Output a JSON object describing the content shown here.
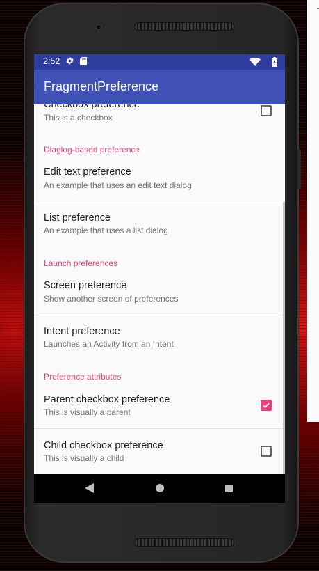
{
  "status_bar": {
    "time": "2:52"
  },
  "app_bar": {
    "title": "FragmentPreference"
  },
  "preferences": {
    "checkbox_pref": {
      "title": "Checkbox preference",
      "summary": "This is a checkbox",
      "checked": false
    },
    "category_dialog": "Diaglog-based preference",
    "edit_text_pref": {
      "title": "Edit text preference",
      "summary": "An example that uses an edit text dialog"
    },
    "list_pref": {
      "title": "List preference",
      "summary": "An example that uses a list dialog"
    },
    "category_launch": "Launch preferences",
    "screen_pref": {
      "title": "Screen preference",
      "summary": "Show another screen of preferences"
    },
    "intent_pref": {
      "title": "Intent preference",
      "summary": "Launches an Activity from an Intent"
    },
    "category_attributes": "Preference attributes",
    "parent_checkbox_pref": {
      "title": "Parent checkbox preference",
      "summary": "This is visually a parent",
      "checked": true
    },
    "child_checkbox_pref": {
      "title": "Child checkbox preference",
      "summary": "This is visually a child",
      "checked": false
    }
  },
  "icons": {
    "status": [
      "gear-icon",
      "sd-card-icon",
      "wifi-icon",
      "battery-icon"
    ],
    "nav": [
      "back-icon",
      "home-icon",
      "recents-icon"
    ]
  },
  "colors": {
    "status_bar": "#303f9f",
    "app_bar": "#3f51b5",
    "accent": "#ec407a",
    "background": "#fafafa"
  }
}
